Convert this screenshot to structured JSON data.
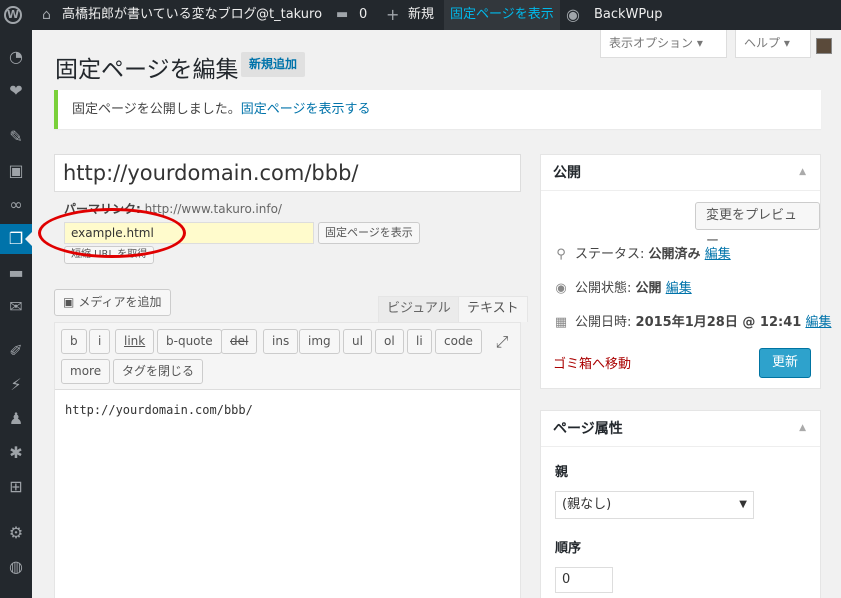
{
  "adminbar": {
    "site_name": "高橋拓郎が書いている変なブログ",
    "user_handle": "@t_takuro",
    "comments_count": "0",
    "new_label": "新規",
    "view_page_label": "固定ページを表示",
    "plugin_label": "BackWPup"
  },
  "screen_meta": {
    "options_label": "表示オプション ▾",
    "help_label": "ヘルプ ▾"
  },
  "page": {
    "title": "固定ページを編集",
    "add_new": "新規追加"
  },
  "notice": {
    "message": "固定ページを公開しました。",
    "link": "固定ページを表示する"
  },
  "editor": {
    "post_title": "http://yourdomain.com/bbb/",
    "permalink_label": "パーマリンク:",
    "permalink_base": "http://www.takuro.info/",
    "slug_value": "example.html",
    "view_page_btn": "固定ページを表示",
    "shortlink_btn": "短縮 URL を取得",
    "media_btn": "メディアを追加",
    "tab_visual": "ビジュアル",
    "tab_text": "テキスト",
    "quicktags": [
      "b",
      "i",
      "link",
      "b-quote",
      "del",
      "ins",
      "img",
      "ul",
      "ol",
      "li",
      "code",
      "more",
      "タグを閉じる"
    ],
    "content": "http://yourdomain.com/bbb/"
  },
  "publish_box": {
    "title": "公開",
    "preview_btn": "変更をプレビュー",
    "status_label": "ステータス:",
    "status_value": "公開済み",
    "visibility_label": "公開状態:",
    "visibility_value": "公開",
    "date_label": "公開日時:",
    "date_value": "2015年1月28日 @ 12:41",
    "edit_link": "編集",
    "trash_link": "ゴミ箱へ移動",
    "update_btn": "更新"
  },
  "page_attributes": {
    "title": "ページ属性",
    "parent_label": "親",
    "parent_value": "(親なし)",
    "order_label": "順序",
    "order_value": "0"
  },
  "sidebar_icons": [
    "dashboard-icon",
    "jetpack-icon",
    "posts-icon",
    "media-icon",
    "links-icon",
    "pages-icon",
    "comments-icon",
    "feedback-icon",
    "appearance-icon",
    "plugins-icon",
    "users-icon",
    "tools-icon",
    "settings-icon",
    "settings2-icon",
    "wordpress-icon"
  ],
  "colors": {
    "adminbar_bg": "#23282d",
    "accent": "#0073aa",
    "notice_border": "#7ad03a",
    "primary_button": "#2ea2cc",
    "annotation": "#e00000"
  }
}
